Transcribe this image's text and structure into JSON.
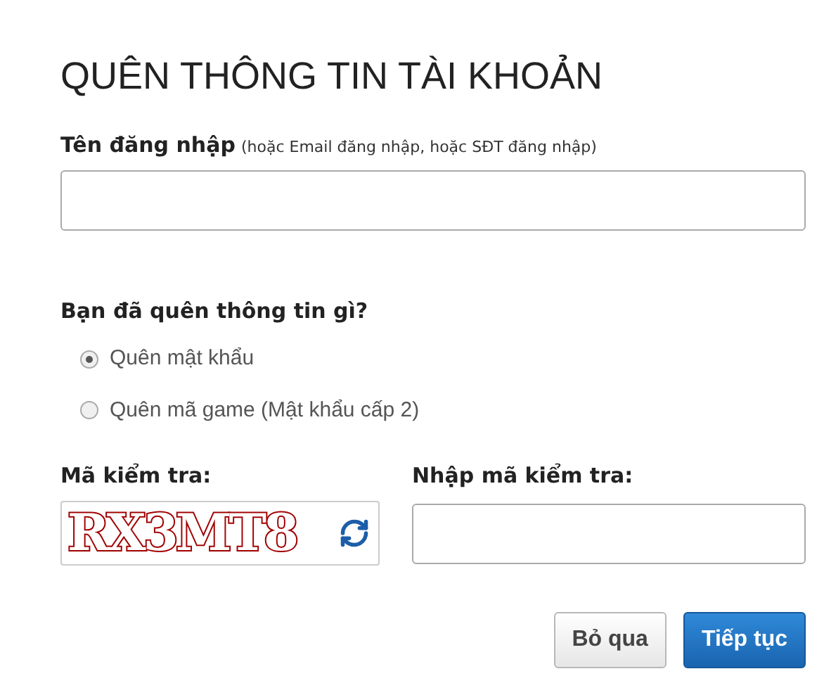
{
  "title": "QUÊN THÔNG TIN TÀI KHOẢN",
  "username": {
    "label": "Tên đăng nhập",
    "hint": "(hoặc Email đăng nhập, hoặc SĐT đăng nhập)"
  },
  "question": "Bạn đã quên thông tin gì?",
  "options": [
    {
      "label": "Quên mật khẩu",
      "selected": true
    },
    {
      "label": "Quên mã game (Mật khẩu cấp 2)",
      "selected": false
    }
  ],
  "captcha": {
    "label": "Mã kiểm tra:",
    "code": "RX3MT8"
  },
  "captcha_input": {
    "label": "Nhập mã kiểm tra:"
  },
  "buttons": [
    {
      "label": "Bỏ qua",
      "kind": "secondary"
    },
    {
      "label": "Tiếp tục",
      "kind": "primary"
    }
  ]
}
